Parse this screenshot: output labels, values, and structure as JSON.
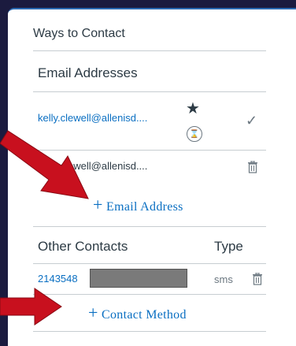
{
  "panel": {
    "title": "Ways to Contact"
  },
  "email_section": {
    "header": "Email Addresses",
    "primary_email": "kelly.clewell@allenisd....",
    "secondary_email": "kelly.clewell@allenisd....",
    "add_label": "Email Address"
  },
  "contacts_section": {
    "header": "Other Contacts",
    "type_header": "Type",
    "phone_partial": "2143548",
    "phone_type": "sms",
    "add_label": "Contact Method"
  },
  "icons": {
    "primary": "star-icon",
    "pending": "hourglass-icon",
    "verified": "check-icon",
    "delete": "trash-icon",
    "add": "plus-icon"
  },
  "colors": {
    "link": "#0a6fc2",
    "arrow": "#c8101e",
    "background": "#1b1b3f"
  }
}
